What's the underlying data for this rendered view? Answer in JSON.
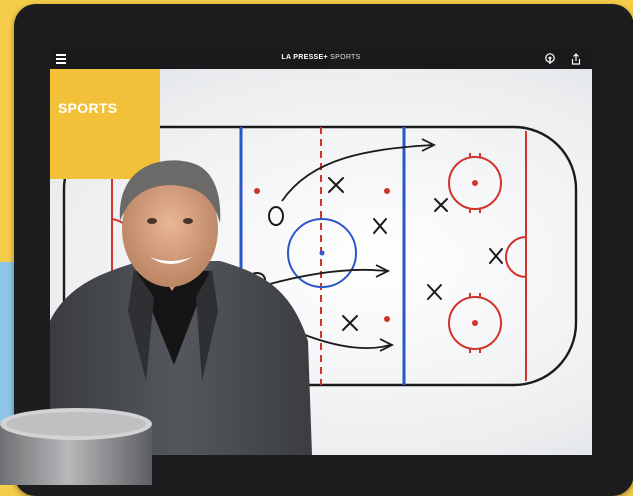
{
  "app": {
    "brand": "LA PRESSE+",
    "section": "SPORTS"
  },
  "header": {
    "menu_icon": "hamburger-menu-icon",
    "podcast_icon": "podcast-icon",
    "share_icon": "share-icon"
  },
  "section_tag": {
    "label": "SPORTS",
    "color": "#f3c03a"
  },
  "colors": {
    "background": "#f5cd4a",
    "rink_red": "#d0342c",
    "rink_blue": "#2c55c8",
    "tablet_frame": "#1c1d1f"
  }
}
